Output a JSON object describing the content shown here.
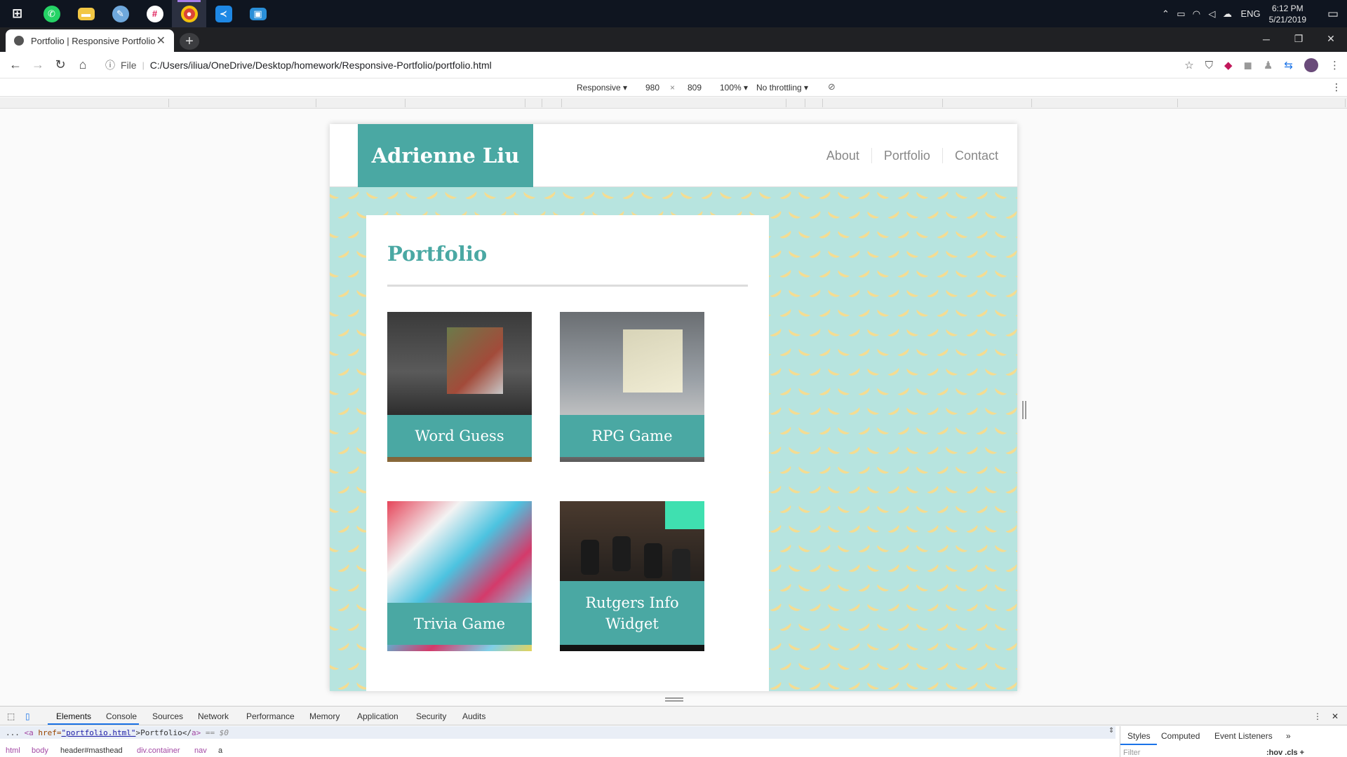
{
  "taskbar": {
    "apps": [
      {
        "icon": "windows-start-icon",
        "color": "#ffffff",
        "glyph": "⊞"
      },
      {
        "icon": "whatsapp-icon",
        "color": "#25d366",
        "glyph": "✆"
      },
      {
        "icon": "file-explorer-icon",
        "color": "#f2c744",
        "glyph": "▬"
      },
      {
        "icon": "paint-app-icon",
        "color": "#6fa8dc",
        "glyph": "✎"
      },
      {
        "icon": "slack-icon",
        "color": "#e01e5a",
        "glyph": "#"
      },
      {
        "icon": "chrome-icon",
        "color": "#db4437",
        "glyph": "◉"
      },
      {
        "icon": "vscode-icon",
        "color": "#1e88e5",
        "glyph": "≺"
      },
      {
        "icon": "app-icon",
        "color": "#2a8fd8",
        "glyph": "▣"
      }
    ],
    "language": "ENG",
    "time": "6:12 PM",
    "date": "5/21/2019"
  },
  "browser": {
    "tab_title": "Portfolio | Responsive Portfolio",
    "file_label": "File",
    "url": "C:/Users/iliua/OneDrive/Desktop/homework/Responsive-Portfolio/portfolio.html"
  },
  "device_toolbar": {
    "mode": "Responsive ▾",
    "width": "980",
    "times": "×",
    "height": "809",
    "zoom": "100% ▾",
    "throttling": "No throttling ▾"
  },
  "page": {
    "brand": "Adrienne Liu",
    "nav": [
      "About",
      "Portfolio",
      "Contact"
    ],
    "title": "Portfolio",
    "colors": {
      "accent": "#4aa8a3",
      "pattern_bg": "#b7e4df",
      "banana": "#f4dc92"
    },
    "projects": [
      {
        "label": "Word Guess",
        "photo": "tablet-photo"
      },
      {
        "label": "RPG Game",
        "photo": "laptop-photo"
      },
      {
        "label": "Trivia Game",
        "photo": "abstract-paint-photo"
      },
      {
        "label": "Rutgers Info Widget",
        "photo": "audio-knobs-photo"
      }
    ]
  },
  "devtools": {
    "tabs": [
      "Elements",
      "Console",
      "Sources",
      "Network",
      "Performance",
      "Memory",
      "Application",
      "Security",
      "Audits"
    ],
    "selected_tab": "Elements",
    "line": {
      "prefix": "...",
      "open_tag": "<a",
      "attr": " href=",
      "value": "\"portfolio.html\"",
      "text": ">Portfolio</",
      "close_tag": "a>",
      "suffix": " == $0"
    },
    "breadcrumbs": [
      "html",
      "body",
      "header#masthead",
      "div.container",
      "nav",
      "a"
    ],
    "side_tabs": [
      "Styles",
      "Computed",
      "Event Listeners",
      "»"
    ],
    "filter_placeholder": "Filter",
    "hov_cls": ":hov  .cls  +"
  }
}
